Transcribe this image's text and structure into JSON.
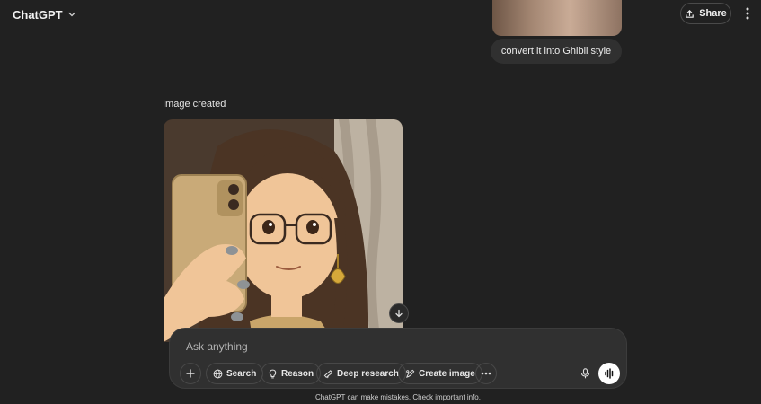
{
  "header": {
    "title": "ChatGPT",
    "share_label": "Share"
  },
  "conversation": {
    "user_message": "convert it into Ghibli style",
    "assistant_status": "Image created"
  },
  "composer": {
    "placeholder": "Ask anything",
    "tools": [
      {
        "label": "Search",
        "icon": "globe-icon"
      },
      {
        "label": "Reason",
        "icon": "lightbulb-icon"
      },
      {
        "label": "Deep research",
        "icon": "telescope-icon"
      },
      {
        "label": "Create image",
        "icon": "image-brush-icon"
      }
    ]
  },
  "footer": {
    "disclaimer": "ChatGPT can make mistakes. Check important info."
  },
  "colors": {
    "background": "#212121",
    "bubble": "#303030",
    "composer": "#303030",
    "text": "#ececec"
  }
}
